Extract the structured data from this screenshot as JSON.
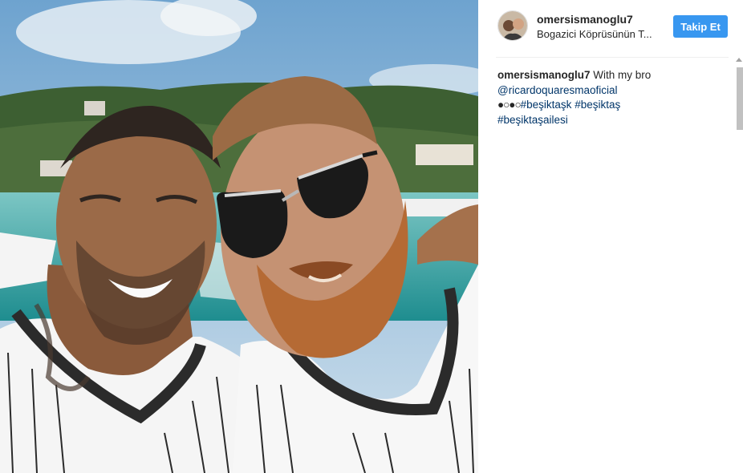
{
  "post": {
    "username": "omersismanoglu7",
    "location": "Bogazici Köprüsünün T...",
    "follow_label": "Takip Et"
  },
  "caption": {
    "username": "omersismanoglu7",
    "text": " With my bro",
    "mention": "@ricardoquaresmaoficial",
    "circles": "●○●○",
    "tags": [
      "#beşiktaşk",
      "#beşiktaş",
      "#beşiktaşailesi"
    ]
  },
  "colors": {
    "accent": "#3897f0",
    "link": "#003569"
  },
  "icons": {
    "scroll_up": "triangle-up-icon"
  }
}
